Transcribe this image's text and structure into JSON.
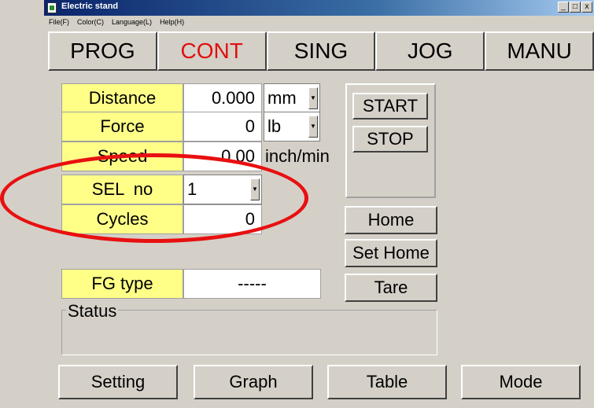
{
  "window": {
    "title": "Electric stand",
    "controls": [
      "_",
      "□",
      "x"
    ]
  },
  "menu": [
    "File(F)",
    "Color(C)",
    "Language(L)",
    "Help(H)"
  ],
  "tabs": [
    {
      "label": "PROG",
      "active": false
    },
    {
      "label": "CONT",
      "active": true
    },
    {
      "label": "SING",
      "active": false
    },
    {
      "label": "JOG",
      "active": false
    },
    {
      "label": "MANU",
      "active": false
    }
  ],
  "fields": {
    "distance": {
      "label": "Distance",
      "value": "0.000",
      "unit": "mm"
    },
    "force": {
      "label": "Force",
      "value": "0",
      "unit": "lb"
    },
    "speed": {
      "label": "Speed",
      "value": "0.00",
      "unit": "inch/min"
    },
    "sel_no": {
      "label": "SEL  no",
      "value": "1"
    },
    "cycles": {
      "label": "Cycles",
      "value": "0"
    },
    "fg_type": {
      "label": "FG type",
      "value": "-----"
    }
  },
  "buttons": {
    "start": "START",
    "stop": "STOP",
    "home": "Home",
    "set_home": "Set Home",
    "tare": "Tare"
  },
  "status": {
    "label": "Status",
    "value": ""
  },
  "bottom_buttons": [
    "Setting",
    "Graph",
    "Table",
    "Mode"
  ],
  "colors": {
    "label_bg": "#ffff88",
    "active_tab": "#e01010",
    "highlight_ring": "#e81010"
  }
}
